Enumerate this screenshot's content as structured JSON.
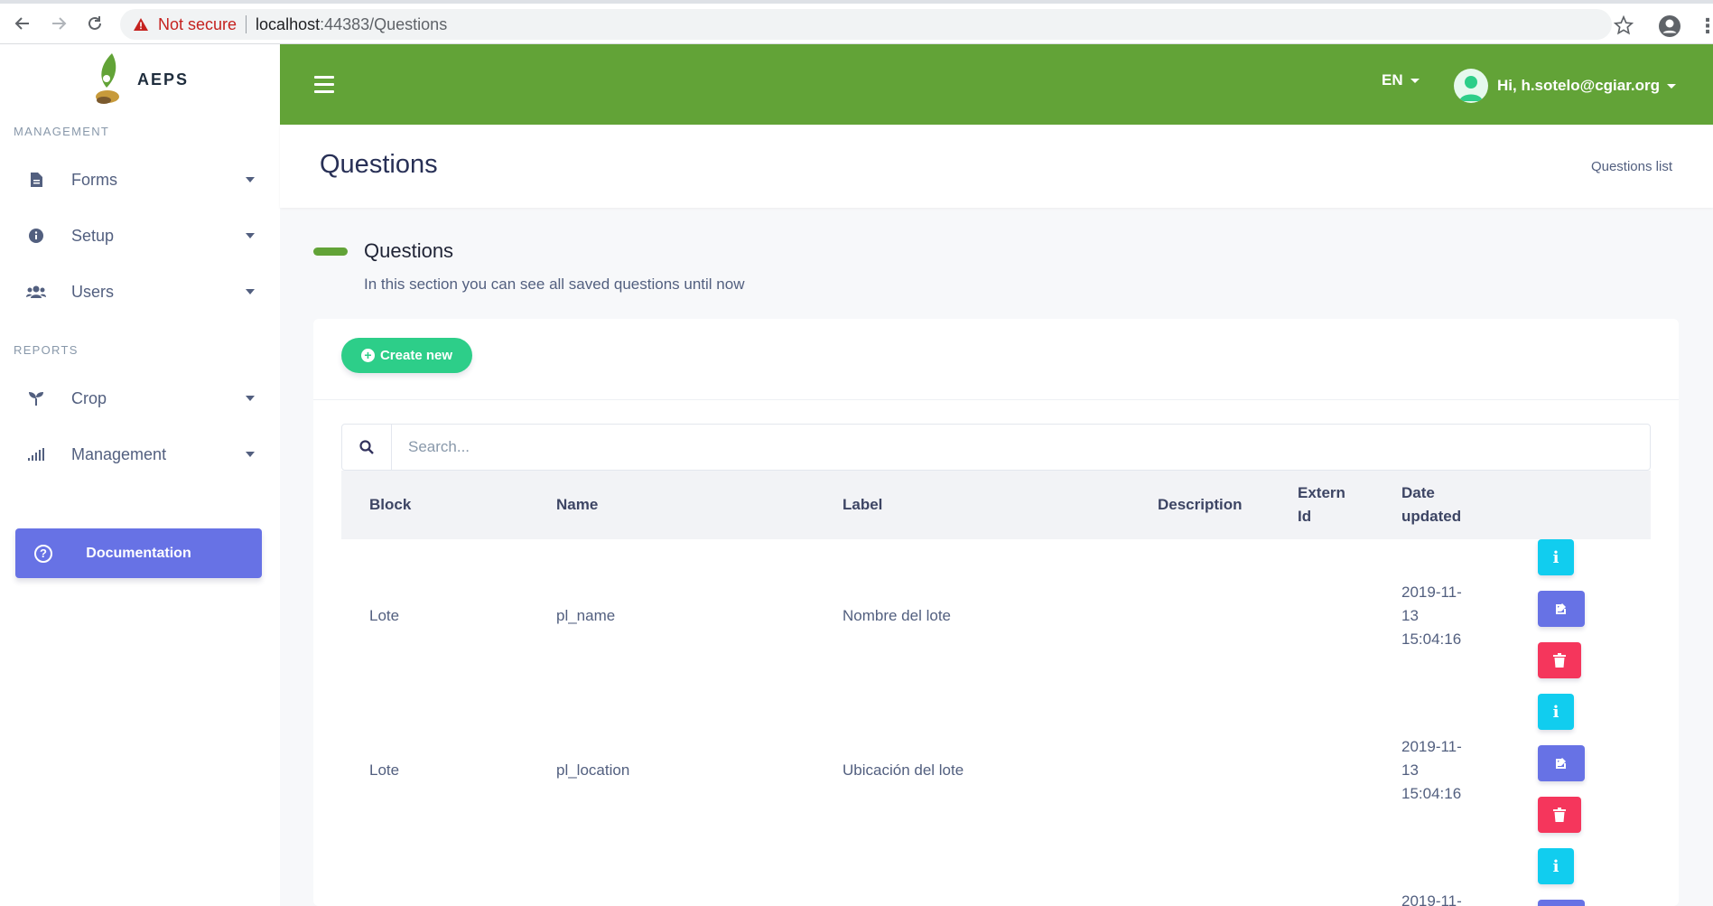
{
  "browser": {
    "not_secure": "Not secure",
    "url_host": "localhost",
    "url_path": ":44383/Questions"
  },
  "sidebar": {
    "logo_text": "AEPS",
    "management_title": "MANAGEMENT",
    "reports_title": "REPORTS",
    "items": [
      {
        "label": "Forms",
        "icon": "file-icon"
      },
      {
        "label": "Setup",
        "icon": "info-circle-icon"
      },
      {
        "label": "Users",
        "icon": "users-icon"
      },
      {
        "label": "Crop",
        "icon": "seedling-icon"
      },
      {
        "label": "Management",
        "icon": "signal-icon"
      }
    ],
    "documentation_label": "Documentation"
  },
  "header": {
    "language": "EN",
    "user_greeting": "Hi, h.sotelo@cgiar.org"
  },
  "page": {
    "title": "Questions",
    "breadcrumb": "Questions list",
    "section_title": "Questions",
    "section_subtitle": "In this section you can see all saved questions until now",
    "create_label": "Create new",
    "search_placeholder": "Search..."
  },
  "table": {
    "headers": {
      "block": "Block",
      "name": "Name",
      "label": "Label",
      "description": "Description",
      "extern_id_1": "Extern",
      "extern_id_2": "Id",
      "date_1": "Date",
      "date_2": "updated"
    },
    "rows": [
      {
        "block": "Lote",
        "name": "pl_name",
        "label": "Nombre del lote",
        "description": "",
        "extern_id": "",
        "date_1": "2019-11-",
        "date_2": "13",
        "date_3": "15:04:16"
      },
      {
        "block": "Lote",
        "name": "pl_location",
        "label": "Ubicación del lote",
        "description": "",
        "extern_id": "",
        "date_1": "2019-11-",
        "date_2": "13",
        "date_3": "15:04:16"
      },
      {
        "block": "",
        "name": "",
        "label": "",
        "description": "",
        "extern_id": "",
        "date_1": "2019-11-",
        "date_2": "",
        "date_3": ""
      }
    ]
  },
  "colors": {
    "primary_green": "#62a337",
    "create_green": "#2dce89",
    "info": "#11cdef",
    "edit": "#6772e5",
    "delete": "#f5365c"
  }
}
